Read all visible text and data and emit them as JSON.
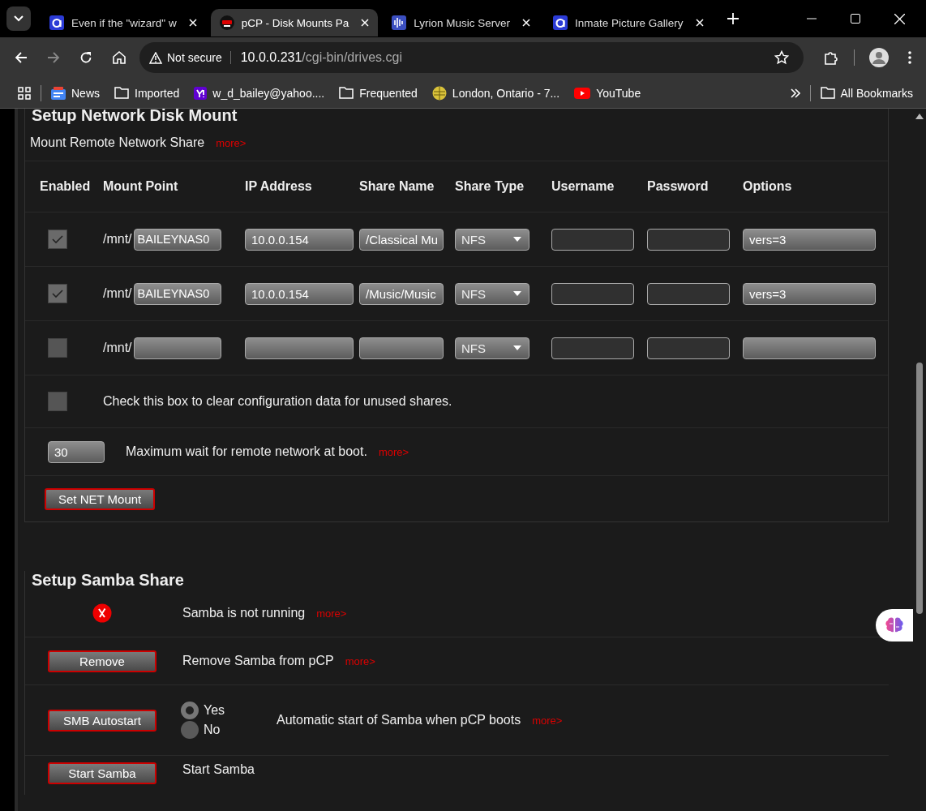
{
  "browser": {
    "tabs": [
      {
        "title": "Even if the \"wizard\" w",
        "kind": "letter",
        "selected": false
      },
      {
        "title": "pCP - Disk Mounts Pa",
        "kind": "pcp",
        "selected": true
      },
      {
        "title": "Lyrion Music Server",
        "kind": "bars",
        "selected": false
      },
      {
        "title": "Inmate Picture Gallery",
        "kind": "letter",
        "selected": false
      }
    ],
    "security": "Not secure",
    "host": "10.0.0.231",
    "path": "/cgi-bin/drives.cgi",
    "bookmarks": [
      {
        "label": "News",
        "kind": "news"
      },
      {
        "label": "Imported",
        "kind": "folder"
      },
      {
        "label": "w_d_bailey@yahoo....",
        "kind": "mail"
      },
      {
        "label": "Frequented",
        "kind": "folder"
      },
      {
        "label": "London, Ontario - 7...",
        "kind": "globe"
      },
      {
        "label": "YouTube",
        "kind": "video"
      }
    ],
    "all_bookmarks": "All Bookmarks"
  },
  "net_mount": {
    "heading": "Setup Network Disk Mount",
    "intro": "Mount Remote Network Share",
    "intro_more": "more>",
    "columns": [
      "Enabled",
      "Mount Point",
      "IP Address",
      "Share Name",
      "Share Type",
      "Username",
      "Password",
      "Options"
    ],
    "rows": [
      {
        "enabled": true,
        "prefix": "/mnt/",
        "mount_point": "BAILEYNAS0",
        "ip": "10.0.0.154",
        "share_name": "/Classical Mu",
        "share_type": "NFS",
        "username": "",
        "password": "",
        "options": "vers=3"
      },
      {
        "enabled": true,
        "prefix": "/mnt/",
        "mount_point": "BAILEYNAS0",
        "ip": "10.0.0.154",
        "share_name": "/Music/Music",
        "share_type": "NFS",
        "username": "",
        "password": "",
        "options": "vers=3"
      },
      {
        "enabled": false,
        "prefix": "/mnt/",
        "mount_point": "",
        "ip": "",
        "share_name": "",
        "share_type": "NFS",
        "username": "",
        "password": "",
        "options": ""
      }
    ],
    "clear_unused": {
      "checked": false,
      "label": "Check this box to clear configuration data for unused shares."
    },
    "max_wait": {
      "value": "30",
      "label": "Maximum wait for remote network at boot.",
      "more": "more>"
    },
    "button": "Set NET Mount"
  },
  "samba": {
    "heading": "Setup Samba Share",
    "status": {
      "running": false,
      "text": "Samba is not running",
      "more": "more>"
    },
    "remove": {
      "button": "Remove",
      "text": "Remove Samba from pCP",
      "more": "more>"
    },
    "autostart": {
      "button": "SMB Autostart",
      "options": [
        {
          "label": "Yes",
          "selected": true
        },
        {
          "label": "No",
          "selected": false
        }
      ],
      "text": "Automatic start of Samba when pCP boots",
      "more": "more>"
    },
    "start": {
      "button": "Start Samba",
      "text": "Start Samba"
    }
  }
}
